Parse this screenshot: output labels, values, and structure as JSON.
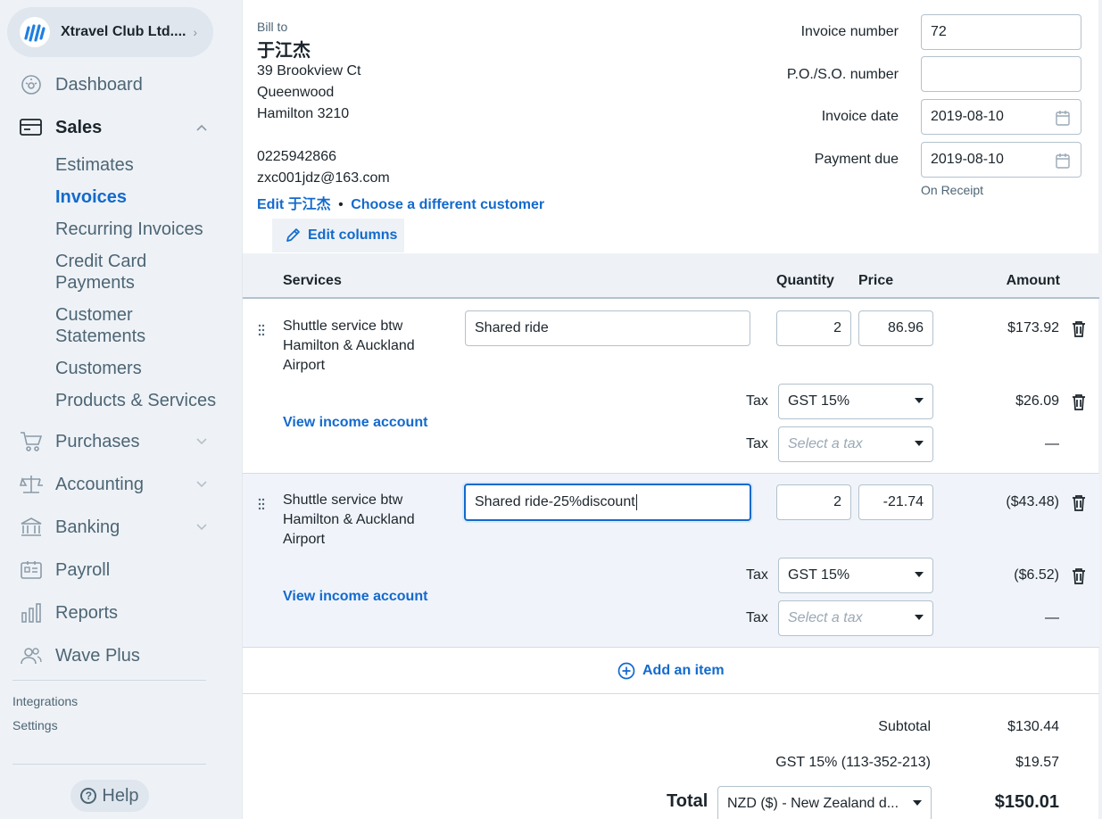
{
  "sidebar": {
    "business_name": "Xtravel Club Ltd....",
    "nav": {
      "dashboard": "Dashboard",
      "sales": "Sales",
      "purchases": "Purchases",
      "accounting": "Accounting",
      "banking": "Banking",
      "payroll": "Payroll",
      "reports": "Reports",
      "wave_plus": "Wave Plus"
    },
    "sales_items": {
      "estimates": "Estimates",
      "invoices": "Invoices",
      "recurring": "Recurring Invoices",
      "credit_card_1": "Credit Card",
      "credit_card_2": "Payments",
      "statements_1": "Customer",
      "statements_2": "Statements",
      "customers": "Customers",
      "products": "Products & Services"
    },
    "integrations": "Integrations",
    "settings": "Settings",
    "help": "Help"
  },
  "bill_to": {
    "label": "Bill to",
    "name": "于江杰",
    "address1": "39 Brookview Ct",
    "address2": "Queenwood",
    "address3": "Hamilton 3210",
    "phone": "0225942866",
    "email": "zxc001jdz@163.com",
    "edit_link": "Edit 于江杰",
    "bullet": "•",
    "choose_link": "Choose a different customer"
  },
  "fields": {
    "invoice_number_label": "Invoice number",
    "invoice_number": "72",
    "po_label": "P.O./S.O. number",
    "po_value": "",
    "invoice_date_label": "Invoice date",
    "invoice_date": "2019-08-10",
    "payment_due_label": "Payment due",
    "payment_due": "2019-08-10",
    "on_receipt": "On Receipt"
  },
  "edit_columns": "Edit columns",
  "table": {
    "headers": {
      "services": "Services",
      "quantity": "Quantity",
      "price": "Price",
      "amount": "Amount"
    },
    "rows": [
      {
        "name_1": "Shuttle service btw",
        "name_2": "Hamilton & Auckland",
        "name_3": "Airport",
        "description": "Shared ride",
        "quantity": "2",
        "price": "86.96",
        "amount": "$173.92",
        "view_income": "View income account",
        "tax_label": "Tax",
        "tax1": "GST 15%",
        "tax1_amount": "$26.09",
        "tax2_placeholder": "Select a tax",
        "tax2_amount": "—"
      },
      {
        "name_1": "Shuttle service btw",
        "name_2": "Hamilton & Auckland",
        "name_3": "Airport",
        "description": "Shared ride-25%discount",
        "quantity": "2",
        "price": "-21.74",
        "amount": "($43.48)",
        "view_income": "View income account",
        "tax_label": "Tax",
        "tax1": "GST 15%",
        "tax1_amount": "($6.52)",
        "tax2_placeholder": "Select a tax",
        "tax2_amount": "—"
      }
    ],
    "add_item": "Add an item"
  },
  "totals": {
    "subtotal_label": "Subtotal",
    "subtotal": "$130.44",
    "gst_label": "GST 15% (113-352-213)",
    "gst": "$19.57",
    "total_label": "Total",
    "currency": "NZD ($) - New Zealand d...",
    "total": "$150.01"
  },
  "colors": {
    "accent": "#136acd",
    "sidebar_bg": "#eef2f6",
    "text": "#1c252c"
  }
}
